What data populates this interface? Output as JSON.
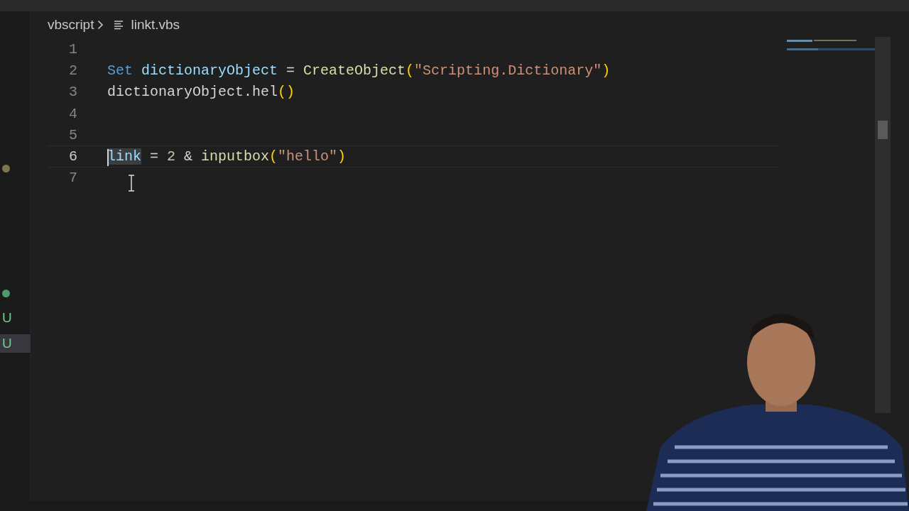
{
  "breadcrumb": {
    "folder": "vbscript",
    "file": "linkt.vbs"
  },
  "sidebar_marks": [
    {
      "kind": "dot",
      "color": "#7d7550"
    },
    {
      "kind": "dot",
      "color": "#4d9a6c"
    },
    {
      "kind": "letter",
      "text": "U",
      "selected": false
    },
    {
      "kind": "letter",
      "text": "U",
      "selected": true
    }
  ],
  "editor": {
    "lines": [
      {
        "number": "1",
        "current": false
      },
      {
        "number": "2",
        "current": false,
        "tokens": [
          {
            "kind": "keyword",
            "text": "Set ",
            "highlighted": false
          },
          {
            "kind": "variable",
            "text": "dictionaryObject",
            "highlighted": false
          },
          {
            "kind": "plain",
            "text": " = ",
            "highlighted": false
          },
          {
            "kind": "function",
            "text": "CreateObject",
            "highlighted": false
          },
          {
            "kind": "bracket",
            "text": "(",
            "highlighted": false
          },
          {
            "kind": "string",
            "text": "\"Scripting.Dictionary\"",
            "highlighted": false
          },
          {
            "kind": "bracket",
            "text": ")",
            "highlighted": false
          }
        ]
      },
      {
        "number": "3",
        "current": false,
        "tokens": [
          {
            "kind": "plain",
            "text": "dictionaryObject.hel",
            "highlighted": false
          },
          {
            "kind": "bracket",
            "text": "()",
            "highlighted": false
          }
        ]
      },
      {
        "number": "4",
        "current": false
      },
      {
        "number": "5",
        "current": false
      },
      {
        "number": "6",
        "current": true,
        "tokens": [
          {
            "kind": "variable",
            "text": "link",
            "highlighted": true
          },
          {
            "kind": "plain",
            "text": " = ",
            "highlighted": false
          },
          {
            "kind": "number",
            "text": "2",
            "highlighted": false
          },
          {
            "kind": "plain",
            "text": " & ",
            "highlighted": false
          },
          {
            "kind": "function",
            "text": "inputbox",
            "highlighted": false
          },
          {
            "kind": "bracket",
            "text": "(",
            "highlighted": false
          },
          {
            "kind": "string",
            "text": "\"hello\"",
            "highlighted": false
          },
          {
            "kind": "bracket",
            "text": ")",
            "highlighted": false
          }
        ]
      },
      {
        "number": "7",
        "current": false
      }
    ]
  }
}
